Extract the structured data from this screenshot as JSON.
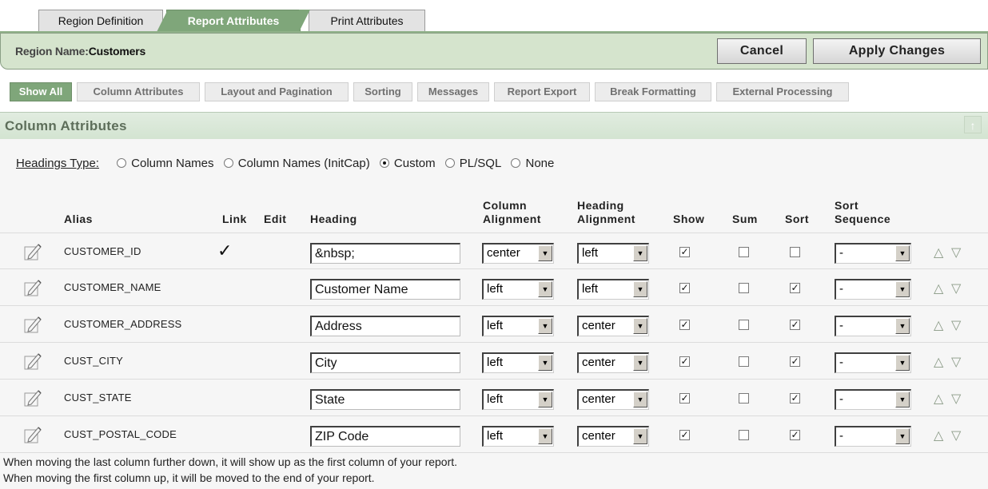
{
  "tabs": [
    {
      "label": "Region Definition",
      "active": false
    },
    {
      "label": "Report Attributes",
      "active": true
    },
    {
      "label": "Print Attributes",
      "active": false
    }
  ],
  "region": {
    "label": "Region Name:",
    "value": "Customers",
    "cancel_label": "Cancel",
    "apply_label": "Apply Changes"
  },
  "subnav": [
    {
      "label": "Show All",
      "active": true
    },
    {
      "label": "Column Attributes",
      "active": false
    },
    {
      "label": "Layout and Pagination",
      "active": false
    },
    {
      "label": "Sorting",
      "active": false
    },
    {
      "label": "Messages",
      "active": false
    },
    {
      "label": "Report Export",
      "active": false
    },
    {
      "label": "Break Formatting",
      "active": false
    },
    {
      "label": "External Processing",
      "active": false
    }
  ],
  "section": {
    "title": "Column Attributes",
    "top_icon": "scroll-to-top-icon"
  },
  "headings_type": {
    "label": "Headings Type:",
    "options": [
      {
        "label": "Column Names",
        "selected": false
      },
      {
        "label": "Column Names (InitCap)",
        "selected": false
      },
      {
        "label": "Custom",
        "selected": true
      },
      {
        "label": "PL/SQL",
        "selected": false
      },
      {
        "label": "None",
        "selected": false
      }
    ]
  },
  "table": {
    "headers": {
      "alias": "Alias",
      "link": "Link",
      "edit": "Edit",
      "heading": "Heading",
      "column_alignment_1": "Column",
      "column_alignment_2": "Alignment",
      "heading_alignment_1": "Heading",
      "heading_alignment_2": "Alignment",
      "show": "Show",
      "sum": "Sum",
      "sort": "Sort",
      "sort_sequence_1": "Sort",
      "sort_sequence_2": "Sequence"
    },
    "rows": [
      {
        "alias": "CUSTOMER_ID",
        "link": true,
        "heading": "&nbsp;",
        "column_alignment": "center",
        "heading_alignment": "left",
        "show": true,
        "sum": false,
        "sort": false,
        "sort_sequence": "-"
      },
      {
        "alias": "CUSTOMER_NAME",
        "link": false,
        "heading": "Customer Name",
        "column_alignment": "left",
        "heading_alignment": "left",
        "show": true,
        "sum": false,
        "sort": true,
        "sort_sequence": "-"
      },
      {
        "alias": "CUSTOMER_ADDRESS",
        "link": false,
        "heading": "Address",
        "column_alignment": "left",
        "heading_alignment": "center",
        "show": true,
        "sum": false,
        "sort": true,
        "sort_sequence": "-"
      },
      {
        "alias": "CUST_CITY",
        "link": false,
        "heading": "City",
        "column_alignment": "left",
        "heading_alignment": "center",
        "show": true,
        "sum": false,
        "sort": true,
        "sort_sequence": "-"
      },
      {
        "alias": "CUST_STATE",
        "link": false,
        "heading": "State",
        "column_alignment": "left",
        "heading_alignment": "center",
        "show": true,
        "sum": false,
        "sort": true,
        "sort_sequence": "-"
      },
      {
        "alias": "CUST_POSTAL_CODE",
        "link": false,
        "heading": "ZIP Code",
        "column_alignment": "left",
        "heading_alignment": "center",
        "show": true,
        "sum": false,
        "sort": true,
        "sort_sequence": "-"
      }
    ]
  },
  "notes": [
    "When moving the last column further down, it will show up as the first column of your report.",
    "When moving the first column up, it will be moved to the end of your report."
  ],
  "colors": {
    "accent_green": "#7fa67a",
    "region_bar": "#d5e4cd",
    "section_header": "#d3e4d1"
  }
}
